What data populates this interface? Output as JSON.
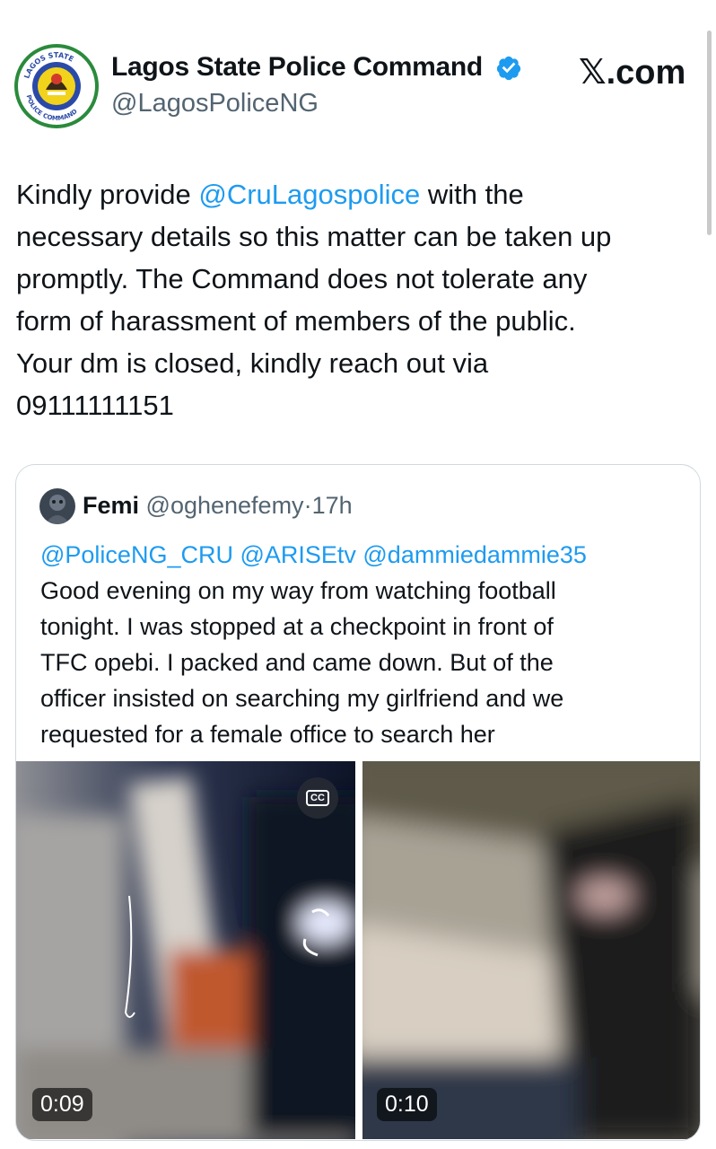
{
  "header": {
    "author_name": "Lagos State Police Command",
    "author_handle": "@LagosPoliceNG",
    "verified_icon": "verified-badge-icon",
    "brand": "𝕏.com",
    "avatar_icon": "police-command-logo",
    "logo_text_top": "LAGOS STATE",
    "logo_text_bottom": "POLICE COMMAND"
  },
  "tweet": {
    "line1_pre": "Kindly provide ",
    "line1_mention": "@CruLagospolice",
    "line1_post": " with the",
    "line2": "necessary details so this matter can be taken up",
    "line3": "promptly. The Command does not tolerate any",
    "line4": "form of harassment of members of the public.",
    "line5": "Your dm is closed, kindly reach out via",
    "line6": "09111111151"
  },
  "quote": {
    "name": "Femi",
    "handle": "@oghenefemy",
    "separator": "·",
    "time": "17h",
    "mentions": "@PoliceNG_CRU @ARISEtv @dammiedammie35",
    "line1": "Good evening on my way from watching football",
    "line2": "tonight. I was stopped at a checkpoint in front of",
    "line3": "TFC opebi. I packed and came down. But of the",
    "line4": "officer insisted on searching my girlfriend and we",
    "line5": "requested for a female office to search her"
  },
  "media": [
    {
      "duration": "0:09",
      "captions_label": "CC"
    },
    {
      "duration": "0:10"
    }
  ],
  "colors": {
    "link": "#1d9bf0",
    "secondary_text": "#536471",
    "primary_text": "#0f1419",
    "verified": "#1d9bf0"
  }
}
